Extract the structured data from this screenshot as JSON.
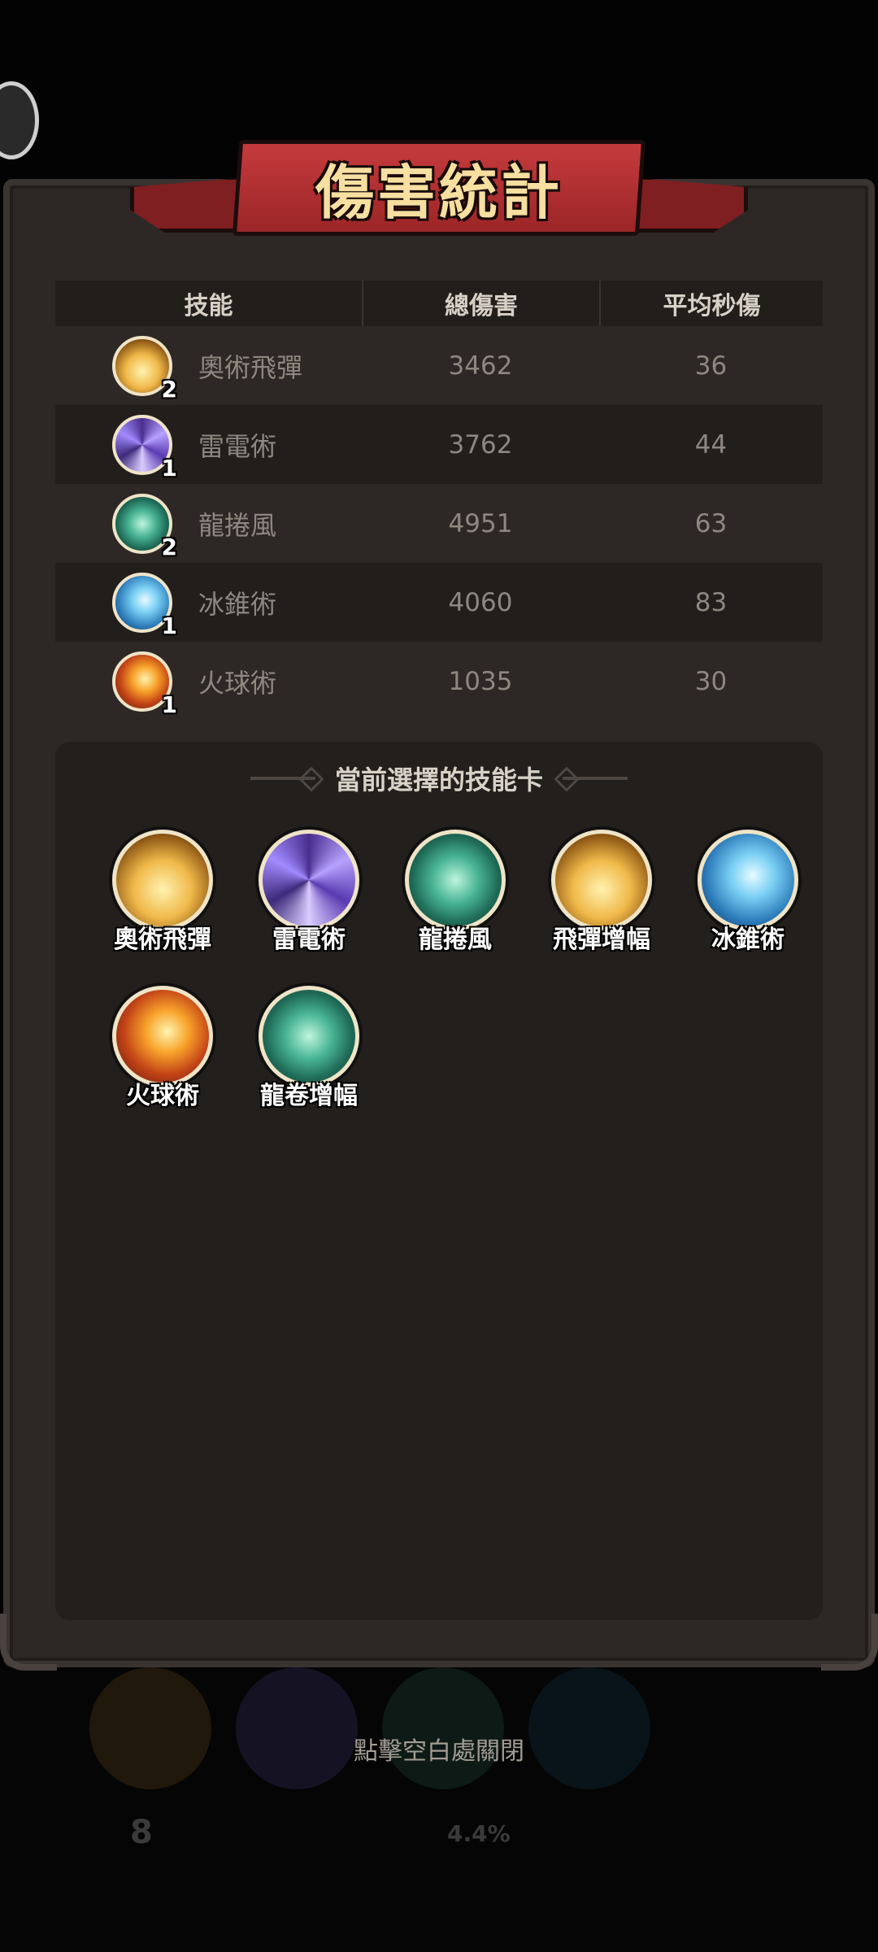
{
  "title": "傷害統計",
  "table": {
    "headers": {
      "skill": "技能",
      "total": "總傷害",
      "dps": "平均秒傷"
    },
    "rows": [
      {
        "icon": "arcane-missile-icon",
        "name": "奧術飛彈",
        "level": "2",
        "total": "3462",
        "dps": "36"
      },
      {
        "icon": "lightning-icon",
        "name": "雷電術",
        "level": "1",
        "total": "3762",
        "dps": "44"
      },
      {
        "icon": "tornado-icon",
        "name": "龍捲風",
        "level": "2",
        "total": "4951",
        "dps": "63"
      },
      {
        "icon": "ice-cone-icon",
        "name": "冰錐術",
        "level": "1",
        "total": "4060",
        "dps": "83"
      },
      {
        "icon": "fireball-icon",
        "name": "火球術",
        "level": "1",
        "total": "1035",
        "dps": "30"
      }
    ]
  },
  "cards": {
    "title": "當前選擇的技能卡",
    "items": [
      {
        "icon": "arcane-missile-icon",
        "label": "奧術飛彈"
      },
      {
        "icon": "lightning-icon",
        "label": "雷電術"
      },
      {
        "icon": "tornado-icon",
        "label": "龍捲風"
      },
      {
        "icon": "missile-boost-icon",
        "label": "飛彈增幅"
      },
      {
        "icon": "ice-cone-icon",
        "label": "冰錐術"
      },
      {
        "icon": "fireball-icon",
        "label": "火球術"
      },
      {
        "icon": "tornado-boost-icon",
        "label": "龍卷增幅"
      }
    ]
  },
  "close_hint": "點擊空白處關閉",
  "background": {
    "level_digit": "8",
    "percent": "4.4%"
  }
}
